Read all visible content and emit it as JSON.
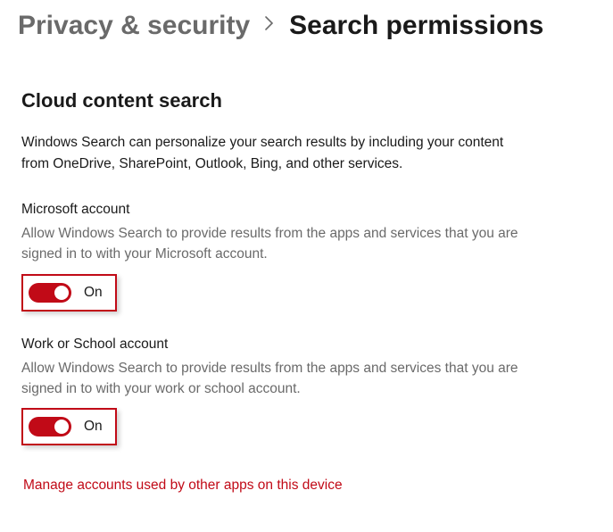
{
  "breadcrumb": {
    "parent": "Privacy & security",
    "current": "Search permissions"
  },
  "section": {
    "heading": "Cloud content search",
    "description": "Windows Search can personalize your search results by including your content from OneDrive, SharePoint, Outlook, Bing, and other services."
  },
  "settings": {
    "microsoft": {
      "title": "Microsoft account",
      "description": "Allow Windows Search to provide results from the apps and services that you are signed in to with your Microsoft account.",
      "toggle_state": "On"
    },
    "work_school": {
      "title": "Work or School account",
      "description": "Allow Windows Search to provide results from the apps and services that you are signed in to with your work or school account.",
      "toggle_state": "On"
    }
  },
  "link": {
    "manage_accounts": "Manage accounts used by other apps on this device"
  },
  "colors": {
    "accent": "#c10a17"
  }
}
